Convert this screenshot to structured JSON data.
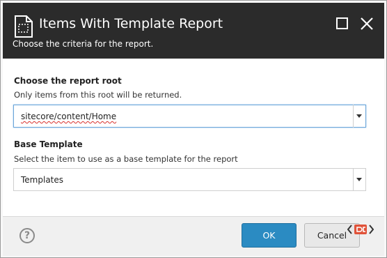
{
  "dialog": {
    "title": "Items With Template Report",
    "subtitle": "Choose the criteria for the report."
  },
  "report_root": {
    "label": "Choose the report root",
    "hint": "Only items from this root will be returned.",
    "value": "sitecore/content/Home"
  },
  "base_template": {
    "label": "Base Template",
    "hint": "Select the item to use as a base template for the report",
    "value": "Templates"
  },
  "footer": {
    "help_symbol": "?",
    "ok_label": "OK",
    "cancel_label": "Cancel"
  },
  "colors": {
    "titlebar": "#2b2b2b",
    "ok_button": "#2b8bc2",
    "logo": "#e0533a"
  },
  "icons": {
    "app": "report-document-icon",
    "maximize": "maximize-icon",
    "close": "close-icon",
    "help": "help-icon",
    "combo": "chevron-down-icon",
    "overlay": "code-brackets-logo-icon"
  }
}
